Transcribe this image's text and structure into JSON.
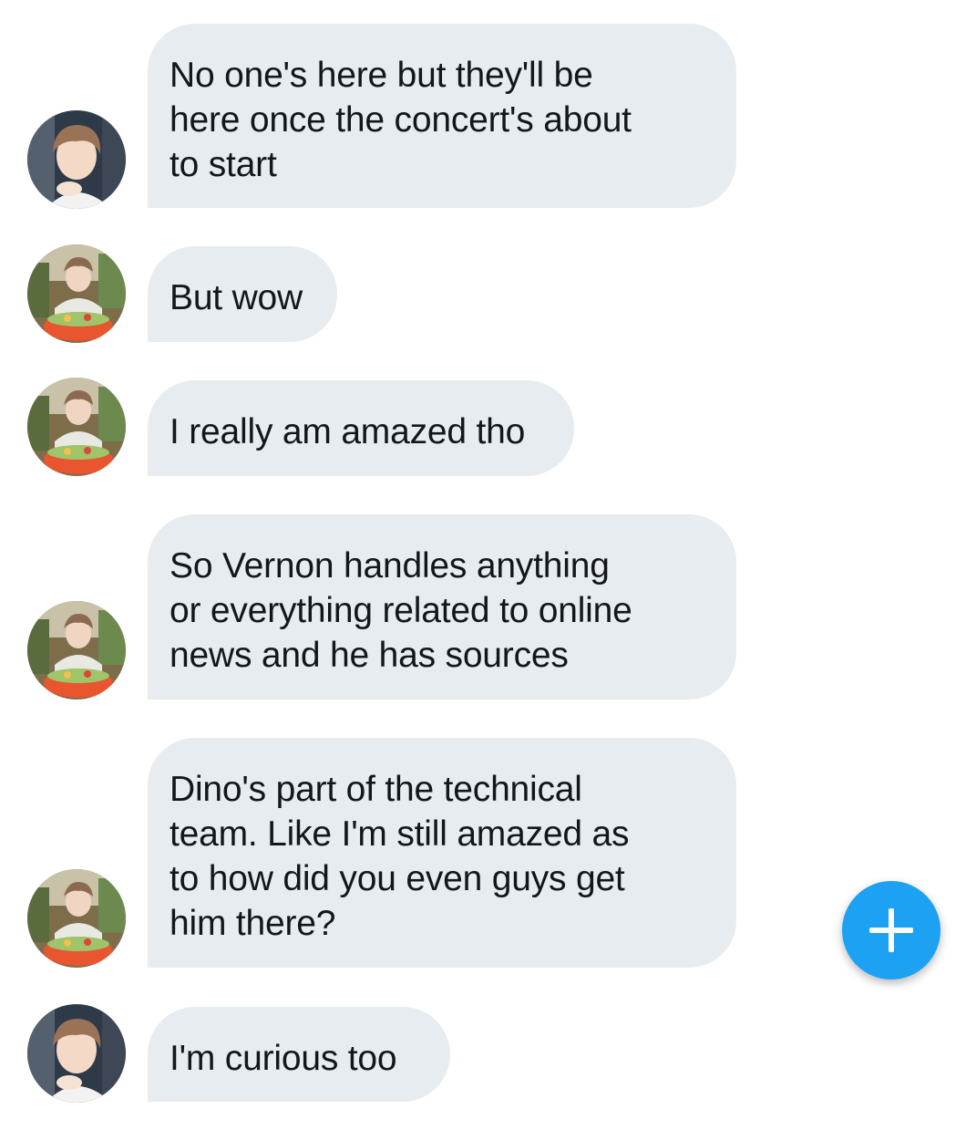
{
  "colors": {
    "bubble_background": "#e6ecf0",
    "text": "#14171a",
    "compose_button": "#1da1f2"
  },
  "messages": [
    {
      "avatar": "portrait-avatar",
      "text": "No one's here but they'll be\nhere once the concert's about\nto start"
    },
    {
      "avatar": "food-photo-avatar",
      "text": "But wow"
    },
    {
      "avatar": "food-photo-avatar",
      "text": "I really am amazed tho"
    },
    {
      "avatar": "food-photo-avatar",
      "text": "So Vernon handles anything\nor everything related to online\nnews and he has sources"
    },
    {
      "avatar": "food-photo-avatar",
      "text": "Dino's part of the technical\nteam. Like I'm still amazed as\nto how did you even guys get\nhim there?"
    },
    {
      "avatar": "portrait-avatar",
      "text": "I'm curious too"
    }
  ],
  "compose_button": {
    "icon": "plus-icon"
  }
}
